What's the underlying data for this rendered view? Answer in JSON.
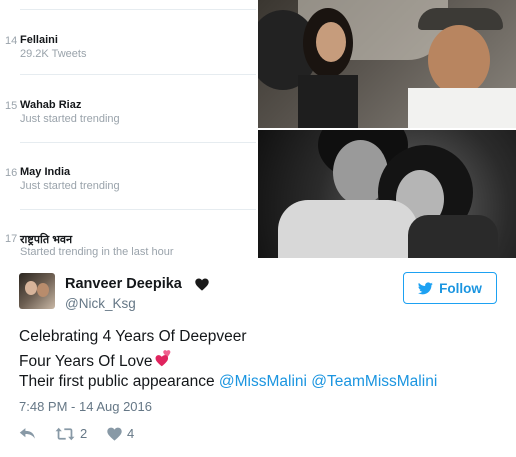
{
  "trends": [
    {
      "rank": "14",
      "name": "Fellaini",
      "subtitle": "29.2K Tweets"
    },
    {
      "rank": "15",
      "name": "Wahab Riaz",
      "subtitle": "Just started trending"
    },
    {
      "rank": "16",
      "name": "May India",
      "subtitle": "Just started trending"
    },
    {
      "rank": "17",
      "name": "राष्ट्रपति भवन",
      "subtitle": "Started trending in the last hour"
    }
  ],
  "tweet": {
    "display_name": "Ranveer Deepika",
    "handle": "@Nick_Ksg",
    "follow_label": "Follow",
    "text_line1": "Celebrating 4 Years Of Deepveer",
    "text_line2": "Four Years Of Love",
    "text_line3_prefix": "Their first public appearance",
    "mention1": "@MissMalini",
    "mention2": "@TeamMissMalini",
    "timestamp": "7:48 PM - 14 Aug 2016",
    "retweet_count": "2",
    "like_count": "4"
  },
  "colors": {
    "accent": "#1da1f2",
    "link": "#1b95e0",
    "muted": "#657786",
    "heart_emoji": "#e0245e"
  },
  "icons": [
    "black-heart-icon",
    "twitter-bird-icon",
    "two-hearts-icon",
    "reply-icon",
    "retweet-icon",
    "like-icon"
  ]
}
